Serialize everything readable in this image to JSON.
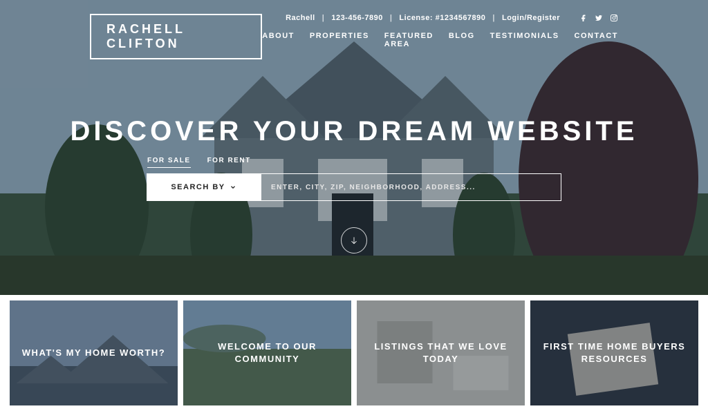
{
  "logo": "RACHELL CLIFTON",
  "meta": {
    "name": "Rachell",
    "phone": "123-456-7890",
    "license": "License: #1234567890",
    "login": "Login/Register"
  },
  "nav": {
    "about": "ABOUT",
    "properties": "PROPERTIES",
    "featured": "FEATURED AREA",
    "blog": "BLOG",
    "testimonials": "TESTIMONIALS",
    "contact": "CONTACT"
  },
  "hero": {
    "title": "DISCOVER YOUR DREAM WEBSITE",
    "tab_sale": "FOR SALE",
    "tab_rent": "FOR RENT",
    "search_by": "SEARCH BY",
    "placeholder": "ENTER, CITY, ZIP, NEIGHBORHOOD, ADDRESS..."
  },
  "cards": {
    "c1": "WHAT'S MY HOME WORTH?",
    "c2": "WELCOME TO OUR COMMUNITY",
    "c3": "LISTINGS THAT WE LOVE TODAY",
    "c4": "FIRST TIME HOME BUYERS RESOURCES"
  }
}
